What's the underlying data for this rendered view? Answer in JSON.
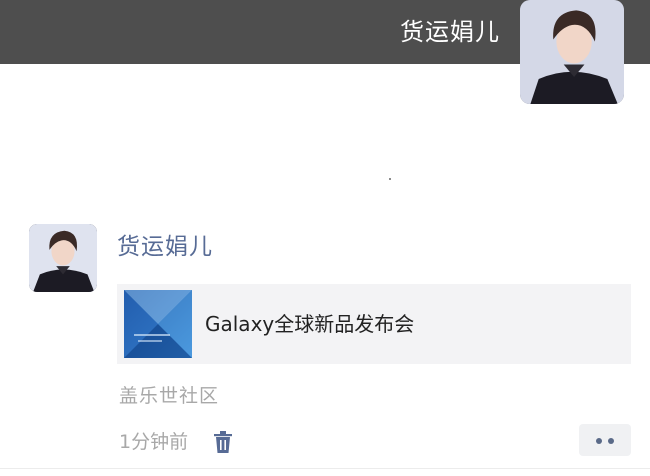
{
  "header": {
    "name": "货运娟儿"
  },
  "post": {
    "author": "货运娟儿",
    "card": {
      "title": "Galaxy全球新品发布会"
    },
    "source": "盖乐世社区",
    "time": "1分钟前"
  },
  "icons": {
    "delete": "trash-icon",
    "more": "more-dots-icon"
  },
  "colors": {
    "header_bg": "#4e4e4e",
    "author_name": "#576b95",
    "meta_text": "#a8a8a8",
    "card_bg": "#f3f3f5"
  }
}
